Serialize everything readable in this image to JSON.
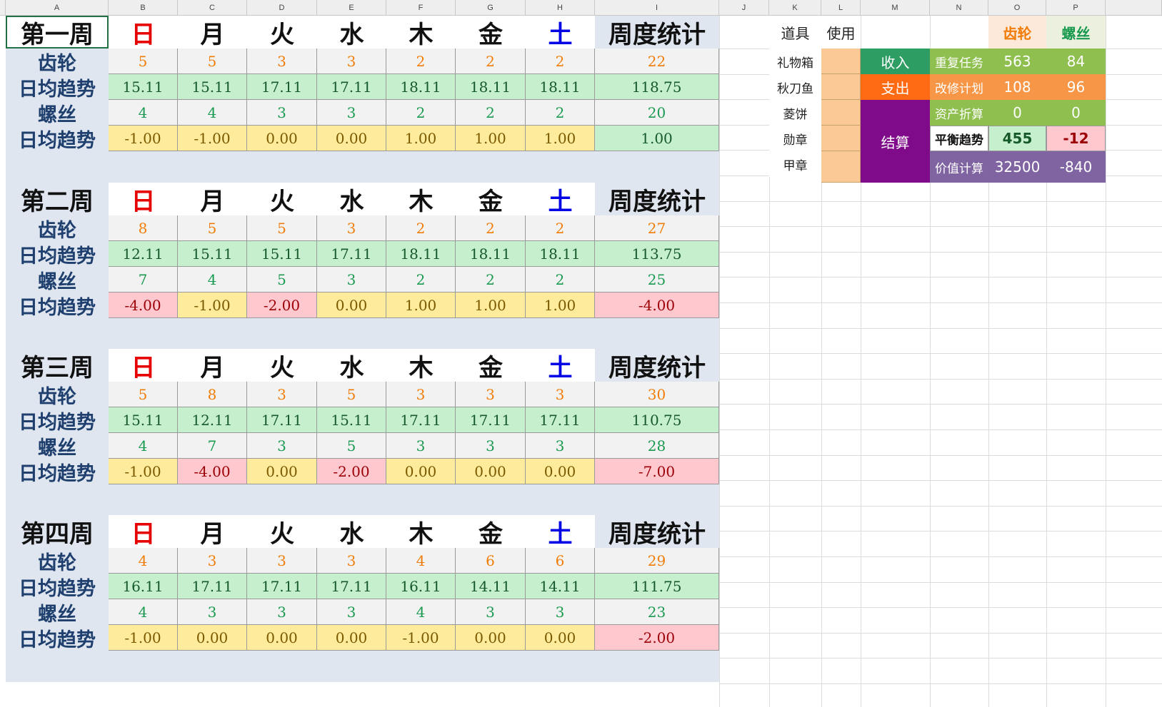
{
  "column_headers": [
    "A",
    "B",
    "C",
    "D",
    "E",
    "F",
    "G",
    "H",
    "I",
    "J",
    "K",
    "L",
    "M",
    "N",
    "O",
    "P"
  ],
  "day_labels": [
    "日",
    "月",
    "火",
    "水",
    "木",
    "金",
    "土"
  ],
  "stat_label": "周度统计",
  "row_labels": {
    "gear": "齿轮",
    "trend": "日均趋势",
    "screw": "螺丝"
  },
  "weeks": [
    {
      "title": "第一周",
      "gear": [
        "5",
        "5",
        "3",
        "3",
        "2",
        "2",
        "2"
      ],
      "gear_total": "22",
      "gear_trend": [
        "15.11",
        "15.11",
        "17.11",
        "17.11",
        "18.11",
        "18.11",
        "18.11"
      ],
      "gear_trend_total": "118.75",
      "screw": [
        "4",
        "4",
        "3",
        "3",
        "2",
        "2",
        "2"
      ],
      "screw_total": "20",
      "screw_trend": [
        "-1.00",
        "-1.00",
        "0.00",
        "0.00",
        "1.00",
        "1.00",
        "1.00"
      ],
      "screw_trend_total": "1.00"
    },
    {
      "title": "第二周",
      "gear": [
        "8",
        "5",
        "5",
        "3",
        "2",
        "2",
        "2"
      ],
      "gear_total": "27",
      "gear_trend": [
        "12.11",
        "15.11",
        "15.11",
        "17.11",
        "18.11",
        "18.11",
        "18.11"
      ],
      "gear_trend_total": "113.75",
      "screw": [
        "7",
        "4",
        "5",
        "3",
        "2",
        "2",
        "2"
      ],
      "screw_total": "25",
      "screw_trend": [
        "-4.00",
        "-1.00",
        "-2.00",
        "0.00",
        "1.00",
        "1.00",
        "1.00"
      ],
      "screw_trend_total": "-4.00"
    },
    {
      "title": "第三周",
      "gear": [
        "5",
        "8",
        "3",
        "5",
        "3",
        "3",
        "3"
      ],
      "gear_total": "30",
      "gear_trend": [
        "15.11",
        "12.11",
        "17.11",
        "15.11",
        "17.11",
        "17.11",
        "17.11"
      ],
      "gear_trend_total": "110.75",
      "screw": [
        "4",
        "7",
        "3",
        "5",
        "3",
        "3",
        "3"
      ],
      "screw_total": "28",
      "screw_trend": [
        "-1.00",
        "-4.00",
        "0.00",
        "-2.00",
        "0.00",
        "0.00",
        "0.00"
      ],
      "screw_trend_total": "-7.00"
    },
    {
      "title": "第四周",
      "gear": [
        "4",
        "3",
        "3",
        "3",
        "4",
        "6",
        "6"
      ],
      "gear_total": "29",
      "gear_trend": [
        "16.11",
        "17.11",
        "17.11",
        "17.11",
        "16.11",
        "14.11",
        "14.11"
      ],
      "gear_trend_total": "111.75",
      "screw": [
        "4",
        "3",
        "3",
        "3",
        "4",
        "3",
        "3"
      ],
      "screw_total": "23",
      "screw_trend": [
        "-1.00",
        "0.00",
        "0.00",
        "0.00",
        "-1.00",
        "0.00",
        "0.00"
      ],
      "screw_trend_total": "-2.00"
    }
  ],
  "items_panel": {
    "header_item": "道具",
    "header_use": "使用",
    "header_gear": "齿轮",
    "header_screw": "螺丝",
    "items": [
      "礼物箱",
      "秋刀鱼",
      "菱饼",
      "勋章",
      "甲章"
    ],
    "income_label": "收入",
    "expense_label": "支出",
    "settle_label": "结算",
    "rows": [
      {
        "label": "重复任务",
        "gear": "563",
        "screw": "84"
      },
      {
        "label": "改修计划",
        "gear": "108",
        "screw": "96"
      },
      {
        "label": "资产折算",
        "gear": "0",
        "screw": "0"
      },
      {
        "label": "平衡趋势",
        "gear": "455",
        "screw": "-12"
      },
      {
        "label": "价值计算",
        "gear": "32500",
        "screw": "-840"
      }
    ]
  },
  "colors": {
    "sunday": "#e60000",
    "saturday": "#0000e6",
    "gear_text": "#f07d0a",
    "screw_text": "#1a9a50",
    "income": "#2e9d63",
    "expense": "#ff6a13",
    "settle": "#7f0a8a",
    "lightgreen": "#8fbf4f",
    "orange": "#f79646",
    "purple": "#8064a2"
  }
}
